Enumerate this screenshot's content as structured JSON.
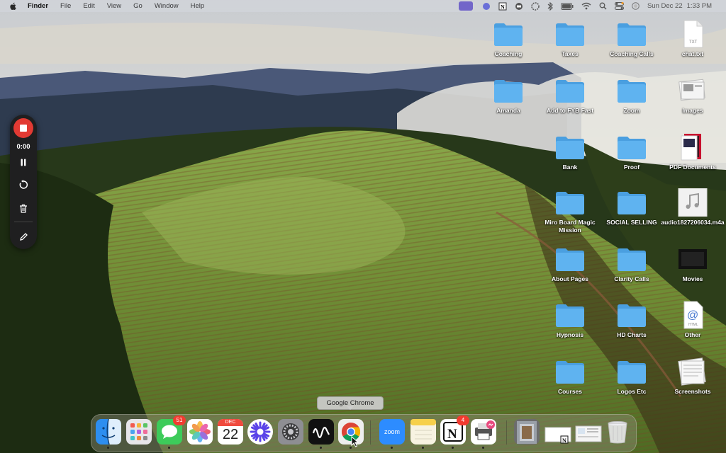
{
  "menubar": {
    "app_name": "Finder",
    "menus": [
      "File",
      "Edit",
      "View",
      "Go",
      "Window",
      "Help"
    ],
    "status_icons": [
      "screen-record-icon",
      "fantastical-icon",
      "notion-icon",
      "zoom-status-icon",
      "loom-icon",
      "bluetooth-icon",
      "battery-icon",
      "wifi-icon",
      "spotlight-icon",
      "control-center-icon",
      "siri-icon"
    ],
    "date": "Sun Dec 22",
    "time": "1:33 PM"
  },
  "recorder": {
    "time": "0:00",
    "controls": [
      "stop-icon",
      "pause-icon",
      "restart-icon",
      "trash-icon",
      "pen-icon"
    ],
    "stop_color": "#e23a33"
  },
  "desktop": {
    "items": [
      {
        "label": "Coaching",
        "icon": "folder-icon"
      },
      {
        "label": "Taxes",
        "icon": "folder-icon"
      },
      {
        "label": "Coaching Calls",
        "icon": "folder-icon"
      },
      {
        "label": "chat.txt",
        "icon": "text-file-icon"
      },
      {
        "label": "Amanda",
        "icon": "folder-icon"
      },
      {
        "label": "Add to FYB Fast",
        "icon": "folder-icon"
      },
      {
        "label": "Zoom",
        "icon": "folder-icon"
      },
      {
        "label": "Images",
        "icon": "image-stack-icon"
      },
      {
        "label": "Bank",
        "icon": "folder-icon"
      },
      {
        "label": "Proof",
        "icon": "folder-icon"
      },
      {
        "label": "PDF Documents",
        "icon": "pdf-stack-icon"
      },
      {
        "label": "Miro Board Magic Mission",
        "icon": "folder-icon"
      },
      {
        "label": "SOCIAL SELLING",
        "icon": "folder-icon"
      },
      {
        "label": "audio1827206034.m4a",
        "icon": "audio-file-icon"
      },
      {
        "label": "About Pages",
        "icon": "folder-icon"
      },
      {
        "label": "Clarity Calls",
        "icon": "folder-icon"
      },
      {
        "label": "Movies",
        "icon": "movie-stack-icon"
      },
      {
        "label": "Hypnosis",
        "icon": "folder-icon"
      },
      {
        "label": "HD Charts",
        "icon": "folder-icon"
      },
      {
        "label": "Other",
        "icon": "html-file-icon"
      },
      {
        "label": "Courses",
        "icon": "folder-icon"
      },
      {
        "label": "Logos Etc",
        "icon": "folder-icon"
      },
      {
        "label": "Screenshots",
        "icon": "screenshot-stack-icon"
      }
    ],
    "folder_color": "#5fb3f0"
  },
  "dock": {
    "tooltip": "Google Chrome",
    "apps": [
      {
        "name": "Finder",
        "icon": "finder-icon",
        "running": true
      },
      {
        "name": "Launchpad",
        "icon": "launchpad-icon",
        "running": false
      },
      {
        "name": "Messages",
        "icon": "messages-icon",
        "running": true,
        "badge": "51"
      },
      {
        "name": "Photos",
        "icon": "photos-icon",
        "running": false
      },
      {
        "name": "Calendar",
        "icon": "calendar-icon",
        "running": false,
        "month": "DEC",
        "day": "22"
      },
      {
        "name": "Perplexity",
        "icon": "starburst-icon",
        "running": false
      },
      {
        "name": "System Settings",
        "icon": "settings-icon",
        "running": false
      },
      {
        "name": "Voice Memo",
        "icon": "waveform-icon",
        "running": true
      },
      {
        "name": "Google Chrome",
        "icon": "chrome-icon",
        "running": true
      },
      {
        "name": "Zoom",
        "icon": "zoom-icon",
        "running": true,
        "text": "zoom"
      },
      {
        "name": "Notes",
        "icon": "notes-icon",
        "running": true
      },
      {
        "name": "Notion",
        "icon": "notion-icon",
        "running": true,
        "badge": "4"
      },
      {
        "name": "Messenger",
        "icon": "messenger-icon",
        "running": true
      }
    ],
    "stacks": [
      "downloads-stack-icon",
      "documents-stack-icon",
      "screenshots-stack-icon",
      "trash-icon"
    ]
  }
}
